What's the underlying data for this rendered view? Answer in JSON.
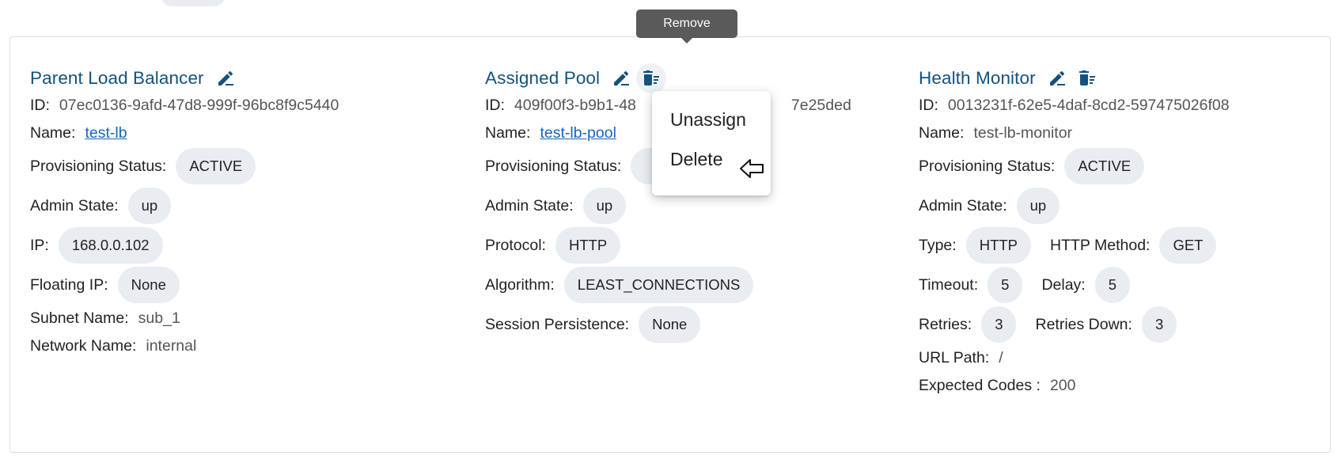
{
  "tooltip": "Remove",
  "menu": {
    "items": [
      "Unassign",
      "Delete"
    ]
  },
  "load_balancer": {
    "title": "Parent Load Balancer",
    "id_label": "ID:",
    "id": "07ec0136-9afd-47d8-999f-96bc8f9c5440",
    "name_label": "Name:",
    "name": "test-lb",
    "prov_label": "Provisioning Status:",
    "prov": "ACTIVE",
    "admin_label": "Admin State:",
    "admin": "up",
    "ip_label": "IP:",
    "ip": "168.0.0.102",
    "fip_label": "Floating IP:",
    "fip": "None",
    "subnet_label": "Subnet Name:",
    "subnet": "sub_1",
    "network_label": "Network Name:",
    "network": "internal"
  },
  "pool": {
    "title": "Assigned Pool",
    "id_label": "ID:",
    "id": "409f00f3-b9b1-48",
    "id_tail": "7e25ded",
    "name_label": "Name:",
    "name": "test-lb-pool",
    "prov_label": "Provisioning Status:",
    "admin_label": "Admin State:",
    "admin": "up",
    "protocol_label": "Protocol:",
    "protocol": "HTTP",
    "algorithm_label": "Algorithm:",
    "algorithm": "LEAST_CONNECTIONS",
    "session_label": "Session Persistence:",
    "session": "None"
  },
  "monitor": {
    "title": "Health Monitor",
    "id_label": "ID:",
    "id": "0013231f-62e5-4daf-8cd2-597475026f08",
    "name_label": "Name:",
    "name": "test-lb-monitor",
    "prov_label": "Provisioning Status:",
    "prov": "ACTIVE",
    "admin_label": "Admin State:",
    "admin": "up",
    "type_label": "Type:",
    "type": "HTTP",
    "method_label": "HTTP Method:",
    "method": "GET",
    "timeout_label": "Timeout:",
    "timeout": "5",
    "delay_label": "Delay:",
    "delay": "5",
    "retries_label": "Retries:",
    "retries": "3",
    "retries_down_label": "Retries Down:",
    "retries_down": "3",
    "url_label": "URL Path:",
    "url": "/",
    "codes_label": "Expected Codes :",
    "codes": "200"
  },
  "colors": {
    "title": "#14527e",
    "link": "#1565c0",
    "chip": "#e9edf1",
    "tooltip": "#5a5a5a"
  },
  "icons": [
    "edit-icon",
    "delete-list-icon",
    "pointing-hand-cursor-icon"
  ]
}
